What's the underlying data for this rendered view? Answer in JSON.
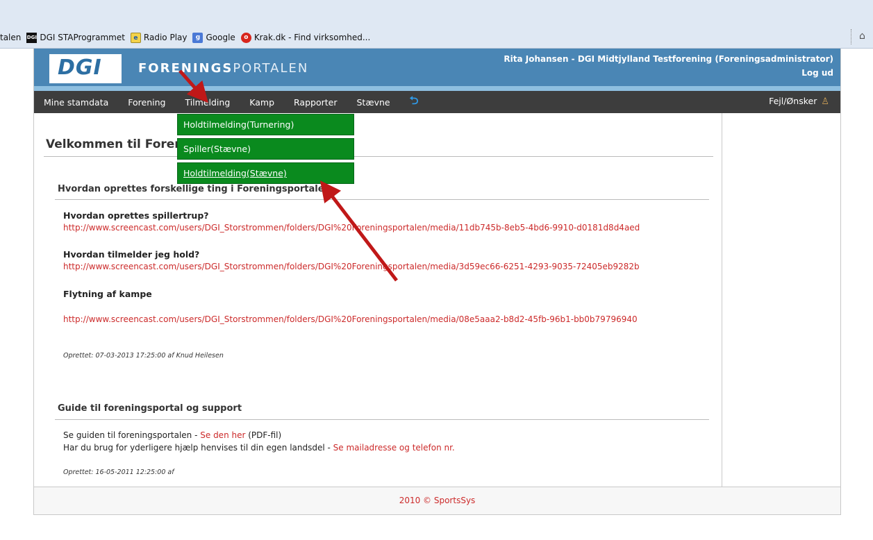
{
  "browser": {
    "favorites": [
      {
        "label": "talen",
        "icon": ""
      },
      {
        "label": "DGI STAProgrammet",
        "icon": "dgi-favicon-icon"
      },
      {
        "label": "Radio Play",
        "icon": "ie-page-icon"
      },
      {
        "label": "Google",
        "icon": "google-favicon-icon"
      },
      {
        "label": "Krak.dk - Find virksomhed...",
        "icon": "krak-favicon-icon"
      }
    ]
  },
  "header": {
    "logo_text": "DGI",
    "portal_title_bold": "FORENINGS",
    "portal_title_rest": "PORTALEN",
    "user": "Rita Johansen - DGI Midtjylland Testforening (Foreningsadministrator)",
    "logout": "Log ud"
  },
  "menu": {
    "items": [
      "Mine stamdata",
      "Forening",
      "Tilmelding",
      "Kamp",
      "Rapporter",
      "Stævne"
    ],
    "feedback": "Fejl/Ønsker"
  },
  "dropdown": {
    "items": [
      "Holdtilmelding(Turnering)",
      "Spiller(Stævne)",
      "Holdtilmelding(Stævne)"
    ]
  },
  "content": {
    "welcome": "Velkommen til Forer",
    "section1": {
      "title": "Hvordan oprettes forskellige ting i Foreningsportalen",
      "q1": "Hvordan oprettes spillertrup?",
      "l1": "http://www.screencast.com/users/DGI_Storstrommen/folders/DGI%20Foreningsportalen/media/11db745b-8eb5-4bd6-9910-d0181d8d4aed",
      "q2": "Hvordan tilmelder jeg hold?",
      "l2": "http://www.screencast.com/users/DGI_Storstrommen/folders/DGI%20Foreningsportalen/media/3d59ec66-6251-4293-9035-72405eb9282b",
      "q3": "Flytning af kampe",
      "l3": "http://www.screencast.com/users/DGI_Storstrommen/folders/DGI%20Foreningsportalen/media/08e5aaa2-b8d2-45fb-96b1-bb0b79796940",
      "meta": "Oprettet: 07-03-2013 17:25:00 af Knud Heilesen"
    },
    "section2": {
      "title": "Guide til foreningsportal og support",
      "line1_pre": "Se guiden til foreningsportalen - ",
      "line1_link": "Se den her",
      "line1_post": " (PDF-fil)",
      "line2_pre": "Har du brug for yderligere hjælp henvises til din egen landsdel - ",
      "line2_link": "Se mailadresse og telefon nr.",
      "meta": "Oprettet: 16-05-2011 12:25:00 af"
    }
  },
  "footer": "2010 © SportsSys",
  "colors": {
    "header_blue": "#4a86b5",
    "menu_dark": "#3d3d3d",
    "dropdown_green": "#0a8a1e",
    "link_red": "#cc2a2a",
    "annotation_arrow": "#c01818"
  }
}
